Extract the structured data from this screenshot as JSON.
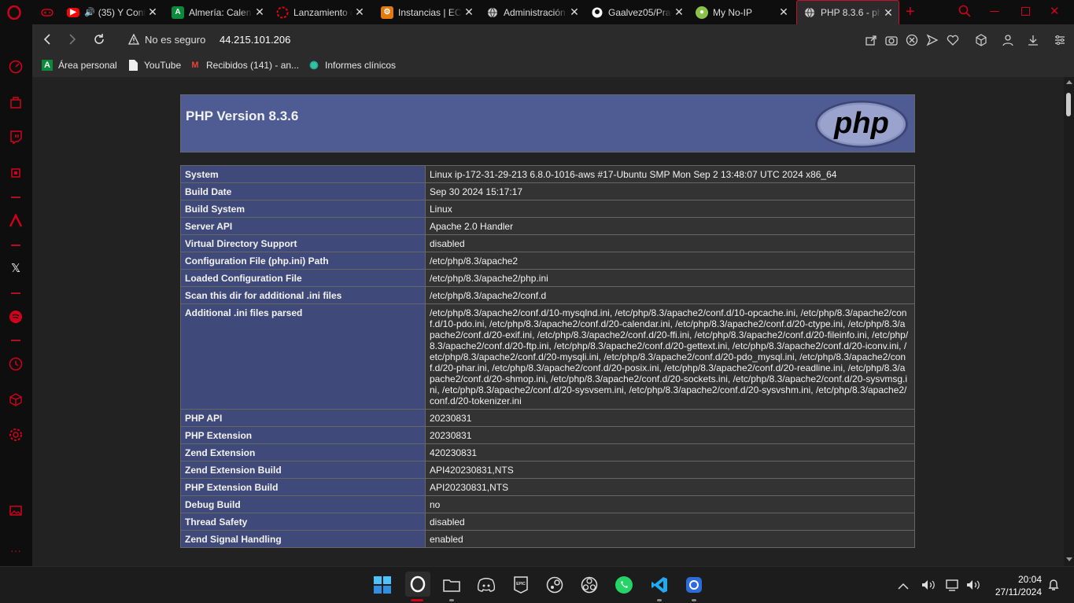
{
  "tabs": [
    {
      "title": "",
      "icon": "gamepad-icon",
      "color": "#d0021b"
    },
    {
      "title": "(35) Y Cont",
      "icon": "youtube-icon",
      "color": "#ff0000"
    },
    {
      "title": "Almería: Calen",
      "icon": "andalucia-icon",
      "color": "#0a8a3a"
    },
    {
      "title": "Lanzamiento d",
      "icon": "redhat-icon",
      "color": "#e00"
    },
    {
      "title": "Instancias | EC",
      "icon": "aws-icon",
      "color": "#e47911"
    },
    {
      "title": "Administración",
      "icon": "globe-icon",
      "color": "#ccc"
    },
    {
      "title": "Gaalvez05/Prac",
      "icon": "github-icon",
      "color": "#fff"
    },
    {
      "title": "My No-IP",
      "icon": "noip-icon",
      "color": "#8bc34a"
    },
    {
      "title": "PHP 8.3.6 - php",
      "icon": "globe-icon",
      "color": "#ccc",
      "active": true
    }
  ],
  "address": {
    "security_label": "No es seguro",
    "url": "44.215.101.206"
  },
  "bookmarks": [
    {
      "label": "Área personal",
      "icon": "andalucia-icon"
    },
    {
      "label": "YouTube",
      "icon": "page-icon"
    },
    {
      "label": "Recibidos (141) - an...",
      "icon": "gmail-icon"
    },
    {
      "label": "Informes clínicos",
      "icon": "gear-green-icon"
    }
  ],
  "php": {
    "title": "PHP Version 8.3.6",
    "logo_text": "php",
    "rows": [
      [
        "System",
        "Linux ip-172-31-29-213 6.8.0-1016-aws #17-Ubuntu SMP Mon Sep 2 13:48:07 UTC 2024 x86_64"
      ],
      [
        "Build Date",
        "Sep 30 2024 15:17:17"
      ],
      [
        "Build System",
        "Linux"
      ],
      [
        "Server API",
        "Apache 2.0 Handler"
      ],
      [
        "Virtual Directory Support",
        "disabled"
      ],
      [
        "Configuration File (php.ini) Path",
        "/etc/php/8.3/apache2"
      ],
      [
        "Loaded Configuration File",
        "/etc/php/8.3/apache2/php.ini"
      ],
      [
        "Scan this dir for additional .ini files",
        "/etc/php/8.3/apache2/conf.d"
      ],
      [
        "Additional .ini files parsed",
        "/etc/php/8.3/apache2/conf.d/10-mysqlnd.ini, /etc/php/8.3/apache2/conf.d/10-opcache.ini, /etc/php/8.3/apache2/conf.d/10-pdo.ini, /etc/php/8.3/apache2/conf.d/20-calendar.ini, /etc/php/8.3/apache2/conf.d/20-ctype.ini, /etc/php/8.3/apache2/conf.d/20-exif.ini, /etc/php/8.3/apache2/conf.d/20-ffi.ini, /etc/php/8.3/apache2/conf.d/20-fileinfo.ini, /etc/php/8.3/apache2/conf.d/20-ftp.ini, /etc/php/8.3/apache2/conf.d/20-gettext.ini, /etc/php/8.3/apache2/conf.d/20-iconv.ini, /etc/php/8.3/apache2/conf.d/20-mysqli.ini, /etc/php/8.3/apache2/conf.d/20-pdo_mysql.ini, /etc/php/8.3/apache2/conf.d/20-phar.ini, /etc/php/8.3/apache2/conf.d/20-posix.ini, /etc/php/8.3/apache2/conf.d/20-readline.ini, /etc/php/8.3/apache2/conf.d/20-shmop.ini, /etc/php/8.3/apache2/conf.d/20-sockets.ini, /etc/php/8.3/apache2/conf.d/20-sysvmsg.ini, /etc/php/8.3/apache2/conf.d/20-sysvsem.ini, /etc/php/8.3/apache2/conf.d/20-sysvshm.ini, /etc/php/8.3/apache2/conf.d/20-tokenizer.ini"
      ],
      [
        "PHP API",
        "20230831"
      ],
      [
        "PHP Extension",
        "20230831"
      ],
      [
        "Zend Extension",
        "420230831"
      ],
      [
        "Zend Extension Build",
        "API420230831,NTS"
      ],
      [
        "PHP Extension Build",
        "API20230831,NTS"
      ],
      [
        "Debug Build",
        "no"
      ],
      [
        "Thread Safety",
        "disabled"
      ],
      [
        "Zend Signal Handling",
        "enabled"
      ]
    ]
  },
  "clock": {
    "time": "20:04",
    "date": "27/11/2024"
  },
  "colors": {
    "opera_red": "#d0021b",
    "php_header": "#4f5b93",
    "php_key": "#404a7a",
    "php_value": "#333333"
  }
}
